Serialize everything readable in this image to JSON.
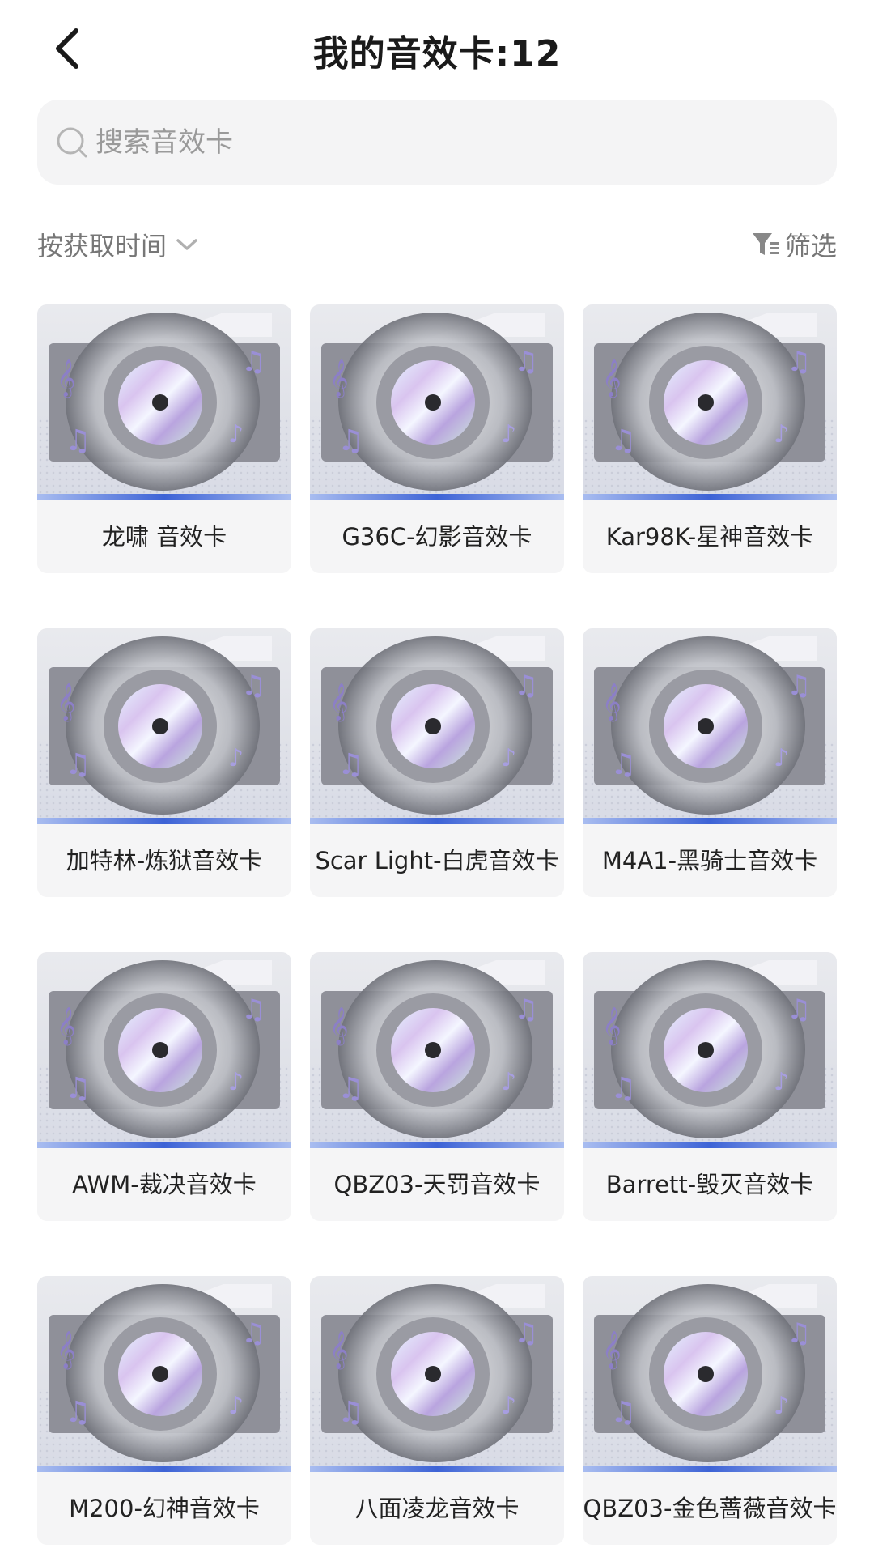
{
  "header": {
    "title": "我的音效卡:12"
  },
  "search": {
    "placeholder": "搜索音效卡"
  },
  "toolbar": {
    "sort_label": "按获取时间",
    "filter_label": "筛选"
  },
  "cards": [
    {
      "label": "龙啸 音效卡"
    },
    {
      "label": "G36C-幻影音效卡"
    },
    {
      "label": "Kar98K-星神音效卡"
    },
    {
      "label": "加特林-炼狱音效卡"
    },
    {
      "label": "Scar Light-白虎音效卡"
    },
    {
      "label": "M4A1-黑骑士音效卡"
    },
    {
      "label": "AWM-裁决音效卡"
    },
    {
      "label": "QBZ03-天罚音效卡"
    },
    {
      "label": "Barrett-毁灭音效卡"
    },
    {
      "label": "M200-幻神音效卡"
    },
    {
      "label": "八面凌龙音效卡"
    },
    {
      "label": "QBZ03-金色蔷薇音效卡"
    }
  ],
  "colors": {
    "accent_bar": "#3d63d6",
    "card_bg": "#f5f5f6",
    "search_bg": "#f4f4f5"
  }
}
